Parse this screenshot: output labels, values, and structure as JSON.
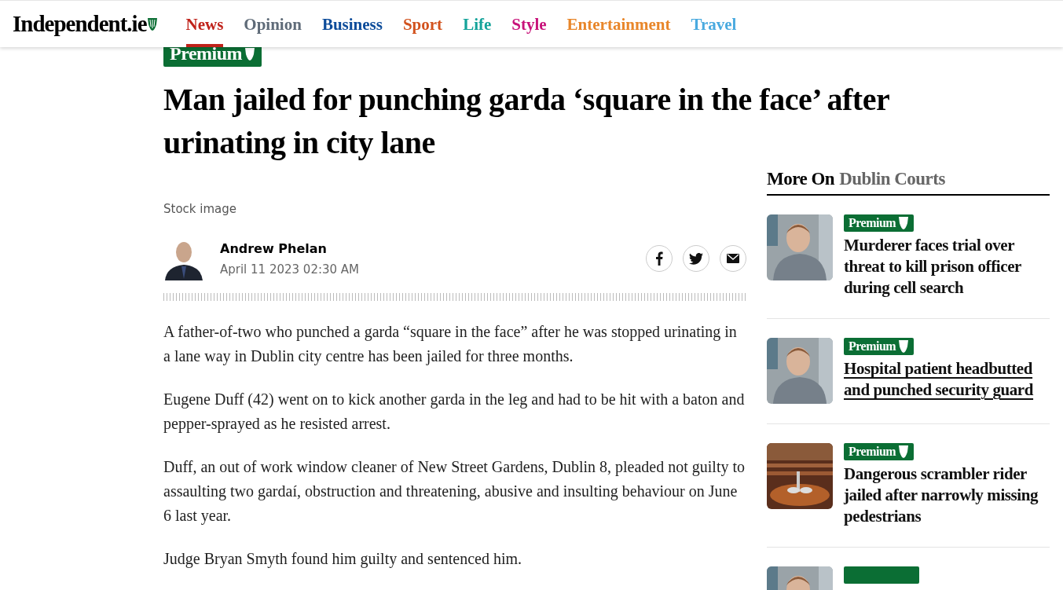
{
  "site": {
    "logo": "Independent.ie"
  },
  "nav": [
    {
      "label": "News",
      "color": "#c0221a",
      "selected": true
    },
    {
      "label": "Opinion",
      "color": "#5f6b78",
      "selected": false
    },
    {
      "label": "Business",
      "color": "#0d4c9a",
      "selected": false
    },
    {
      "label": "Sport",
      "color": "#d2521d",
      "selected": false
    },
    {
      "label": "Life",
      "color": "#14a39a",
      "selected": false
    },
    {
      "label": "Style",
      "color": "#c8127a",
      "selected": false
    },
    {
      "label": "Entertainment",
      "color": "#e8862a",
      "selected": false
    },
    {
      "label": "Travel",
      "color": "#4aaadf",
      "selected": false
    }
  ],
  "article": {
    "badge": "Premium",
    "headline": "Man jailed for punching garda ‘square in the face’ after urinating in city lane",
    "caption": "Stock image",
    "author": "Andrew Phelan",
    "date": "April 11 2023 02:30 AM",
    "paragraphs": [
      "A father-of-two who punched a garda “square in the face” after he was stopped urinating in a lane way in Dublin city centre has been jailed for three months.",
      "Eugene Duff (42) went on to kick another garda in the leg and had to be hit with a baton and pepper-sprayed as he resisted arrest.",
      "Duff, an out of work window cleaner of New Street Gardens, Dublin 8, pleaded not guilty to assaulting two gardaí, obstruction and threatening, abusive and insulting behaviour on June 6 last year.",
      "Judge Bryan Smyth found him guilty and sentenced him."
    ]
  },
  "sidebar": {
    "title": "More On",
    "topic": "Dublin Courts",
    "items": [
      {
        "badge": "Premium",
        "headline": "Murderer faces trial over threat to kill prison officer during cell search",
        "hovered": false,
        "kind": "picture"
      },
      {
        "badge": "Premium",
        "headline": "Hospital patient headbutted and punched security guard",
        "hovered": true,
        "kind": "picture"
      },
      {
        "badge": "Premium",
        "headline": "Dangerous scrambler rider jailed after narrowly missing pedestrians",
        "hovered": false,
        "kind": "picture"
      },
      {
        "kind": "picture"
      }
    ]
  }
}
